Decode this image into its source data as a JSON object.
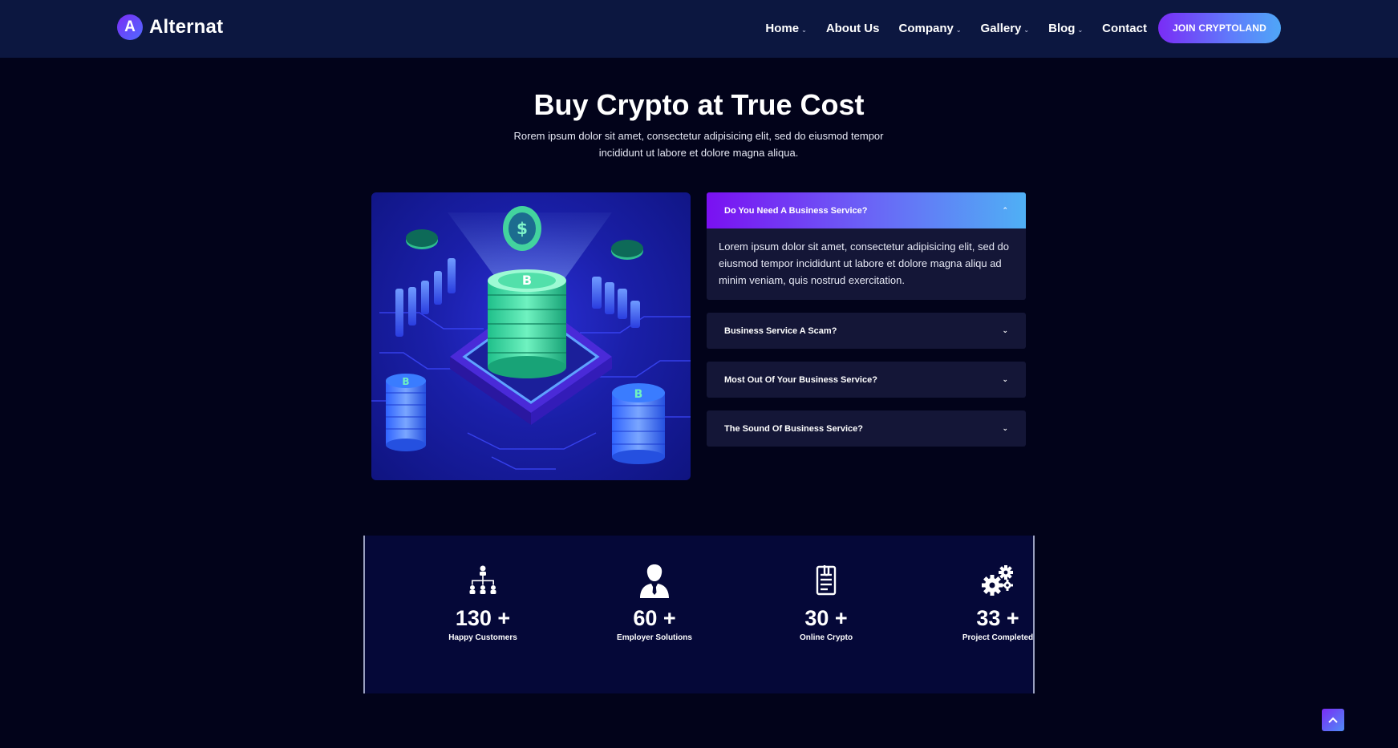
{
  "header": {
    "logo_letter": "A",
    "logo_text": "Alternat",
    "nav": [
      {
        "label": "Home",
        "has_dropdown": true
      },
      {
        "label": "About Us",
        "has_dropdown": false
      },
      {
        "label": "Company",
        "has_dropdown": true
      },
      {
        "label": "Gallery",
        "has_dropdown": true
      },
      {
        "label": "Blog",
        "has_dropdown": true
      },
      {
        "label": "Contact",
        "has_dropdown": false
      }
    ],
    "cta_label": "JOIN CRYPTOLAND"
  },
  "section": {
    "title": "Buy Crypto at True Cost",
    "subtitle": "Rorem ipsum dolor sit amet, consectetur adipisicing elit, sed do eiusmod tempor incididunt ut labore et dolore magna aliqua."
  },
  "accordion": [
    {
      "title": "Do You Need A Business Service?",
      "expanded": true,
      "body": "Lorem ipsum dolor sit amet, consectetur adipisicing elit, sed do eiusmod tempor incididunt ut labore et dolore magna aliqu ad minim veniam, quis nostrud exercitation."
    },
    {
      "title": "Business Service A Scam?",
      "expanded": false
    },
    {
      "title": "Most Out Of Your Business Service?",
      "expanded": false
    },
    {
      "title": "The Sound Of Business Service?",
      "expanded": false
    }
  ],
  "stats": [
    {
      "icon": "org-chart-icon",
      "value": "130",
      "suffix": "+",
      "label": "Happy Customers"
    },
    {
      "icon": "businessman-icon",
      "value": "60",
      "suffix": "+",
      "label": "Employer Solutions"
    },
    {
      "icon": "document-clip-icon",
      "value": "30",
      "suffix": "+",
      "label": "Online Crypto"
    },
    {
      "icon": "gears-icon",
      "value": "33",
      "suffix": "+",
      "label": "Project Completed"
    }
  ],
  "colors": {
    "page_bg": "#02031a",
    "header_bg": "#0c1740",
    "accent_purple": "#7a10f2",
    "accent_blue": "#4fb0f5",
    "card_bg": "#141637",
    "stats_bg": "#050838"
  }
}
